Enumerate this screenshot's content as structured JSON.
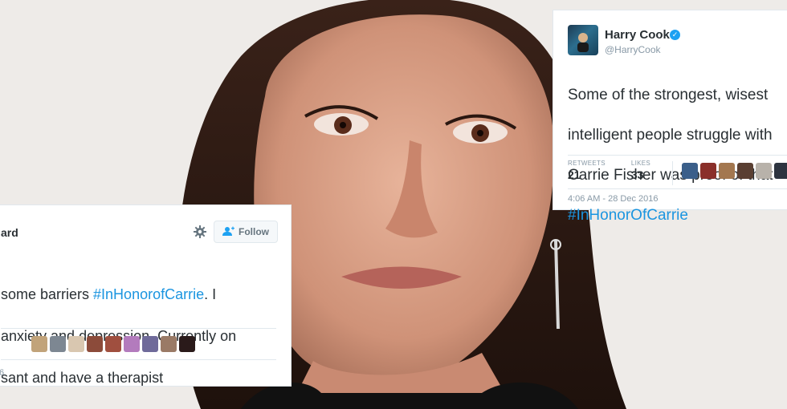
{
  "tweet_right": {
    "name": "Harry Cook",
    "handle": "@HarryCook",
    "text_lines": [
      "Some of the strongest, wisest",
      "intelligent people struggle with",
      "Carrie Fisher was proof of that",
      "#InHonorOfCarrie"
    ],
    "retweets_label": "RETWEETS",
    "retweets_value": "21",
    "likes_label": "LIKES",
    "likes_value": "33",
    "timestamp": "4:06 AM - 28 Dec 2016",
    "avatar_colors": [
      "#3b5f8a",
      "#8a2f2a",
      "#a3774f",
      "#5a3f32",
      "#b8b2aa",
      "#2d3440"
    ]
  },
  "tweet_left": {
    "name": "ard",
    "follow_label": "Follow",
    "text_line1_prefix": "some barriers ",
    "text_line1_hashtag": "#InHonorofCarrie",
    "text_line1_suffix": ". I",
    "text_line2": "anxiety and depression. Currently on",
    "text_line3": "sant and have a therapist",
    "timestamp": "6",
    "avatar_colors": [
      "#c1a37a",
      "#7d8792",
      "#d9c7b0",
      "#8c4b3a",
      "#a04f3f",
      "#b37bbd",
      "#6f6a9a",
      "#9a7a66",
      "#2a1a1a"
    ]
  },
  "colors": {
    "hashtag": "#1b95e0",
    "verified": "#1da1f2",
    "muted": "#8899a6"
  }
}
